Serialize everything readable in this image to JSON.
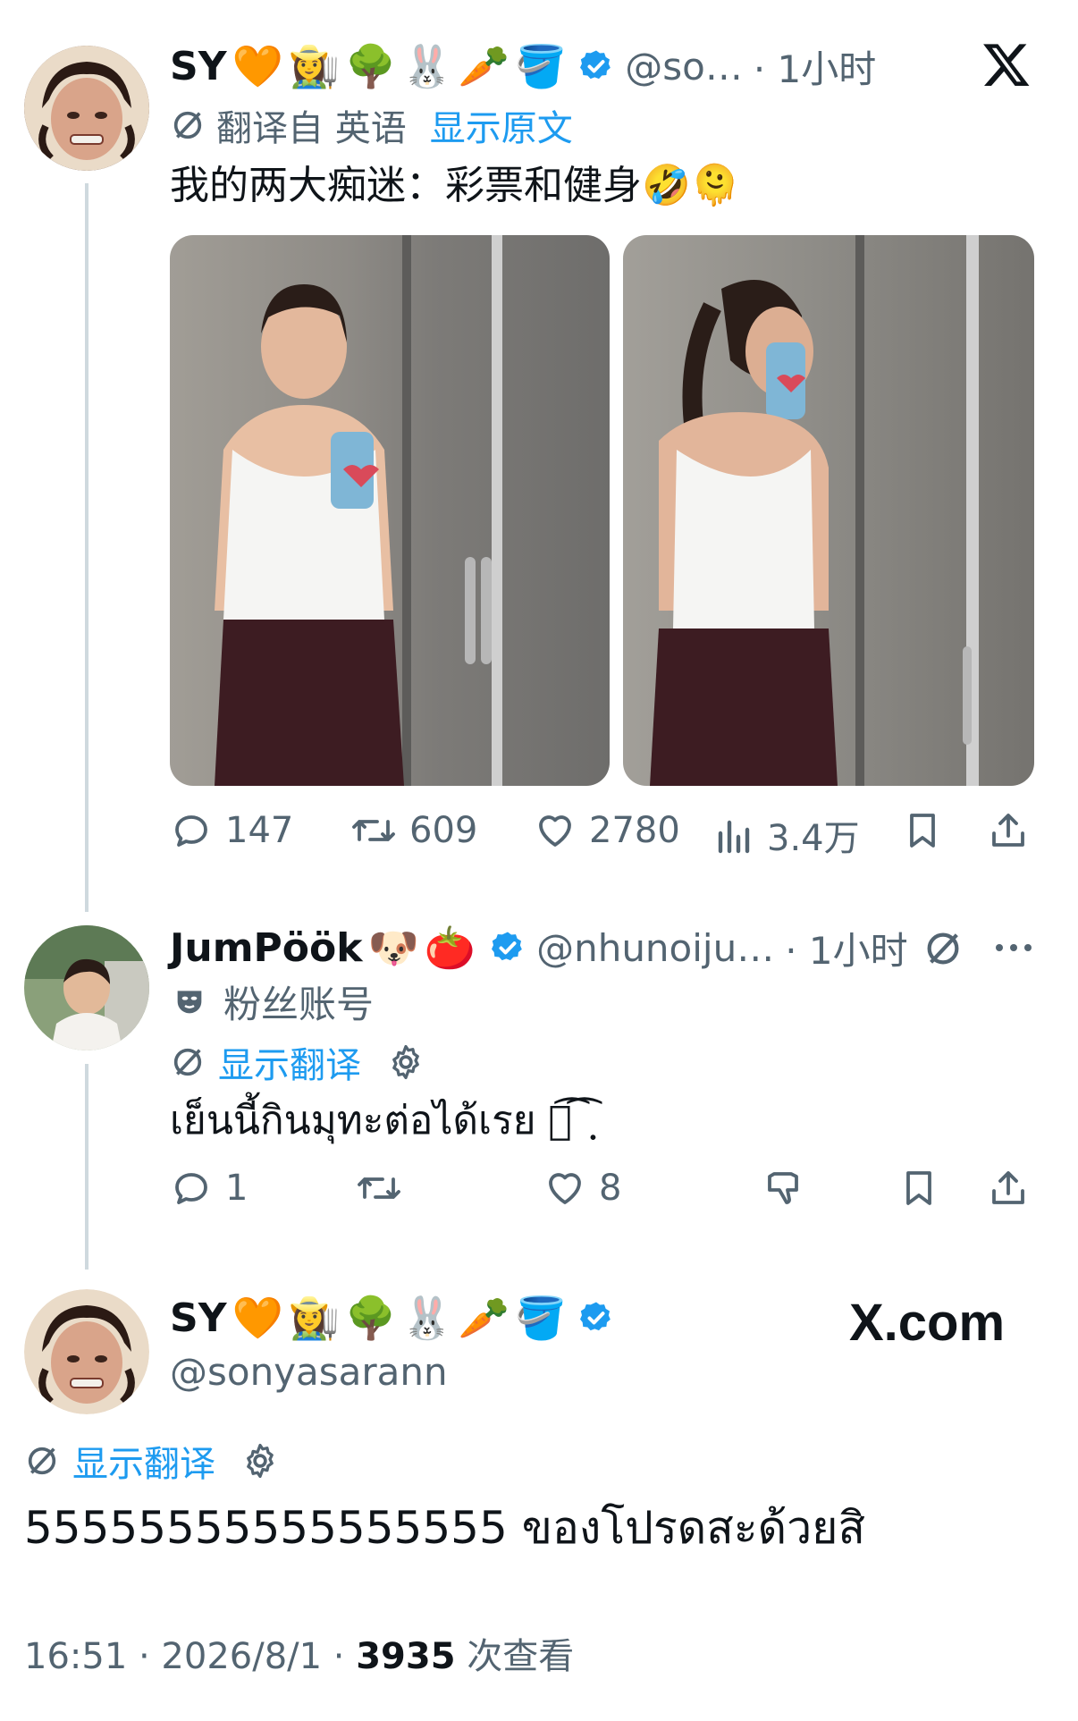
{
  "colors": {
    "text": "#0f1419",
    "gray": "#536471",
    "accent": "#1d9bf0",
    "line": "#cfd9de"
  },
  "tweet1": {
    "name": "SY",
    "emojis": [
      "🧡",
      "👩‍🌾",
      "🌳",
      "🐰",
      "🥕",
      "🪣"
    ],
    "handle": "@so…",
    "time": "· 1小时",
    "translated_from": "翻译自 英语",
    "show_original": "显示原文",
    "text": "我的两大痴迷：彩票和健身🤣🫠",
    "stats": {
      "replies": "147",
      "retweets": "609",
      "likes": "2780",
      "views": "3.4万"
    }
  },
  "tweet2": {
    "name": "JumPöök",
    "emojis": [
      "🐶",
      "🍅"
    ],
    "handle": "@nhunoiju…",
    "time": "· 1小时",
    "fan_account": "粉丝账号",
    "show_translation": "显示翻译",
    "text": "เย็นนี้กินมุทะต่อได้เรย ฺ͡ ͡ ฺ",
    "stats": {
      "replies": "1",
      "likes": "8"
    }
  },
  "tweet3": {
    "name": "SY",
    "emojis": [
      "🧡",
      "👩‍🌾",
      "🌳",
      "🐰",
      "🥕",
      "🪣"
    ],
    "handle": "@sonyasarann",
    "watermark": "X.com",
    "show_translation": "显示翻译",
    "text": "55555555555555555 ของโปรดสะด้วยสิ",
    "time_date": "16:51 · 2026/8/1 · ",
    "views_count": "3935",
    "views_label": " 次查看"
  }
}
